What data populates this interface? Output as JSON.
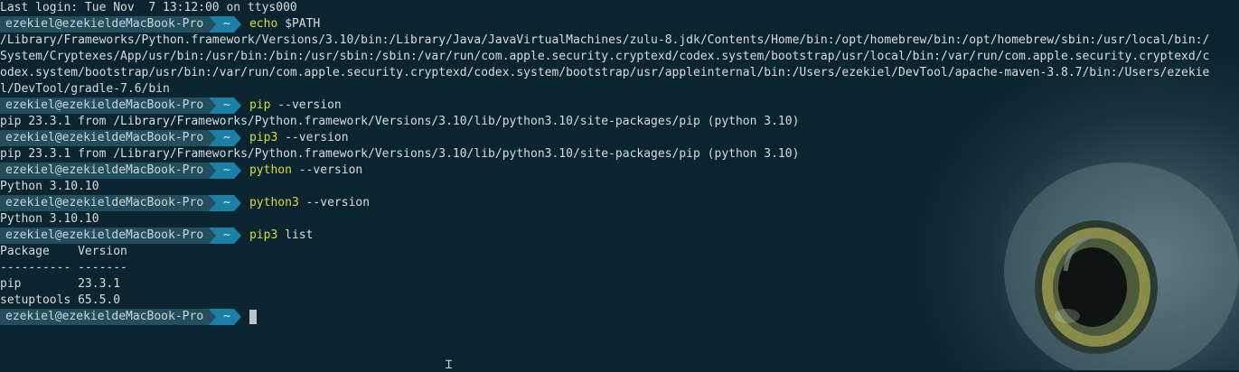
{
  "terminal": {
    "last_login": "Last login: Tue Nov  7 13:12:00 on ttys000",
    "prompt_user": "ezekiel@ezekieldeMacBook-Pro",
    "prompt_dir": "~",
    "entries": [
      {
        "cmd": "echo",
        "args": " $PATH",
        "output": [
          "/Library/Frameworks/Python.framework/Versions/3.10/bin:/Library/Java/JavaVirtualMachines/zulu-8.jdk/Contents/Home/bin:/opt/homebrew/bin:/opt/homebrew/sbin:/usr/local/bin:/",
          "System/Cryptexes/App/usr/bin:/usr/bin:/bin:/usr/sbin:/sbin:/var/run/com.apple.security.cryptexd/codex.system/bootstrap/usr/local/bin:/var/run/com.apple.security.cryptexd/c",
          "odex.system/bootstrap/usr/bin:/var/run/com.apple.security.cryptexd/codex.system/bootstrap/usr/appleinternal/bin:/Users/ezekiel/DevTool/apache-maven-3.8.7/bin:/Users/ezekie",
          "l/DevTool/gradle-7.6/bin"
        ]
      },
      {
        "cmd": "pip",
        "args": " --version",
        "output": [
          "pip 23.3.1 from /Library/Frameworks/Python.framework/Versions/3.10/lib/python3.10/site-packages/pip (python 3.10)"
        ]
      },
      {
        "cmd": "pip3",
        "args": " --version",
        "output": [
          "pip 23.3.1 from /Library/Frameworks/Python.framework/Versions/3.10/lib/python3.10/site-packages/pip (python 3.10)"
        ]
      },
      {
        "cmd": "python",
        "args": " --version",
        "output": [
          "Python 3.10.10"
        ]
      },
      {
        "cmd": "python3",
        "args": " --version",
        "output": [
          "Python 3.10.10"
        ]
      },
      {
        "cmd": "pip3",
        "args": " list",
        "output": [
          "Package    Version",
          "---------- -------",
          "pip        23.3.1",
          "setuptools 65.5.0"
        ]
      }
    ]
  },
  "colors": {
    "background": "#0b2530",
    "prompt_user_bg": "#234e5e",
    "prompt_dir_bg": "#1c7fa6",
    "command": "#d8dd34",
    "text": "#d4dde0"
  },
  "icons": {
    "cursor": "text-cursor-icon",
    "background_art": "owl-wallpaper"
  }
}
